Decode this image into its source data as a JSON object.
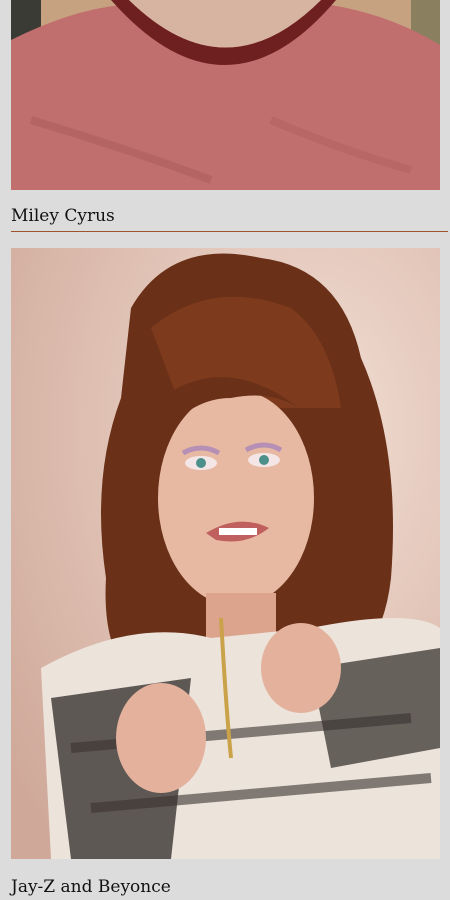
{
  "gallery": {
    "items": [
      {
        "caption": "",
        "image_alt": "man-in-red-t-shirt-photo"
      },
      {
        "caption": "Miley Cyrus",
        "image_alt": "miley-cyrus-yearbook-photo"
      },
      {
        "caption": "Jay-Z and Beyonce"
      }
    ]
  },
  "colors": {
    "background": "#dcdcdc",
    "divider": "#a0522d",
    "caption_text": "#111111"
  }
}
